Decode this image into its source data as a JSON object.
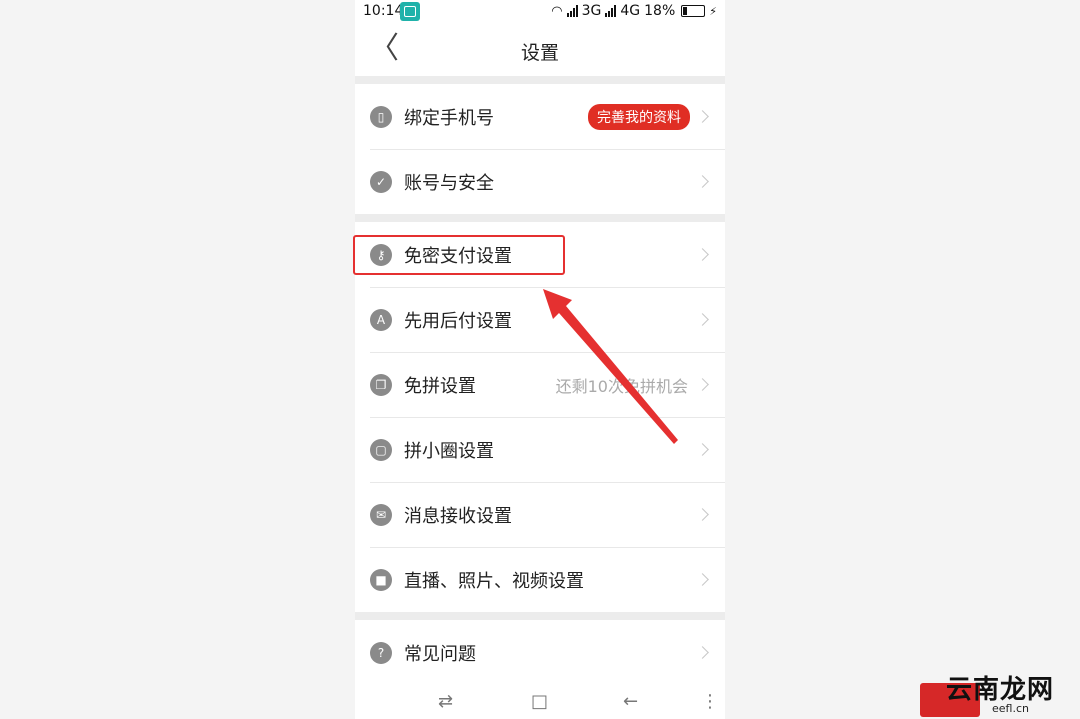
{
  "status": {
    "time": "10:14",
    "net1": "3G",
    "net2": "4G",
    "battery": "18%",
    "battery_level": 0.18
  },
  "header": {
    "back_glyph": "〈",
    "title": "设置"
  },
  "groups": [
    {
      "items": [
        {
          "label": "绑定手机号",
          "icon": "phone-icon",
          "badge": "完善我的资料"
        },
        {
          "label": "账号与安全",
          "icon": "shield-icon"
        }
      ]
    },
    {
      "items": [
        {
          "label": "免密支付设置",
          "icon": "key-icon"
        },
        {
          "label": "先用后付设置",
          "icon": "badge-icon"
        },
        {
          "label": "免拼设置",
          "icon": "cards-icon",
          "right_text": "还剩10次免拼机会"
        },
        {
          "label": "拼小圈设置",
          "icon": "lock-icon"
        },
        {
          "label": "消息接收设置",
          "icon": "mail-icon"
        },
        {
          "label": "直播、照片、视频设置",
          "icon": "camera-icon"
        }
      ]
    },
    {
      "items": [
        {
          "label": "常见问题",
          "icon": "help-icon"
        }
      ]
    }
  ],
  "softkeys": [
    "⇄",
    "□",
    "←",
    "⋮"
  ],
  "watermark": {
    "text": "云南龙网",
    "url": "eefl.cn"
  },
  "colors": {
    "accent": "#e02e24",
    "icon_gray": "#8a8a8a",
    "annotation": "#e53030"
  }
}
